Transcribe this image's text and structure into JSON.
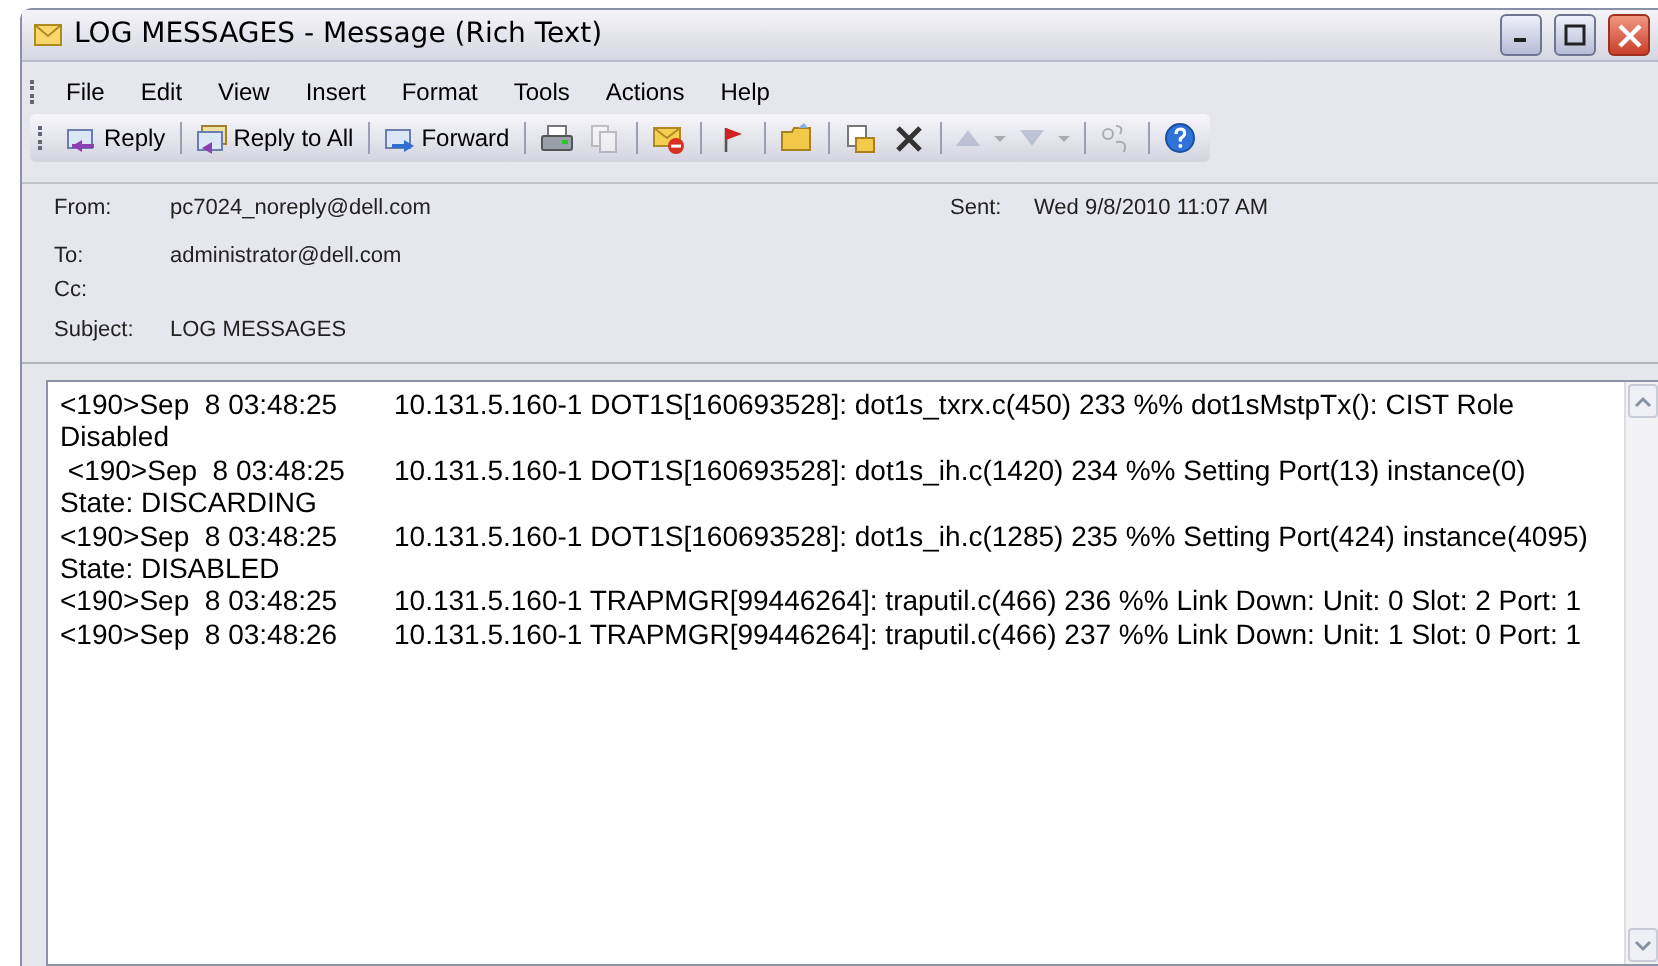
{
  "window": {
    "title": "LOG MESSAGES - Message (Rich Text)"
  },
  "menu": [
    "File",
    "Edit",
    "View",
    "Insert",
    "Format",
    "Tools",
    "Actions",
    "Help"
  ],
  "toolbar": [
    {
      "kind": "labeled",
      "label": "Reply",
      "disabled": false
    },
    {
      "kind": "separator"
    },
    {
      "kind": "labeled",
      "label": "Reply to All",
      "disabled": false
    },
    {
      "kind": "separator"
    },
    {
      "kind": "labeled",
      "label": "Forward",
      "disabled": false
    },
    {
      "kind": "separator"
    },
    {
      "kind": "icon",
      "disabled": false
    },
    {
      "kind": "icon",
      "disabled": true
    },
    {
      "kind": "separator"
    },
    {
      "kind": "icon",
      "disabled": false
    },
    {
      "kind": "separator"
    },
    {
      "kind": "icon",
      "disabled": false
    },
    {
      "kind": "separator"
    },
    {
      "kind": "icon",
      "disabled": false
    },
    {
      "kind": "separator"
    },
    {
      "kind": "icon",
      "disabled": false
    },
    {
      "kind": "icon",
      "disabled": false
    },
    {
      "kind": "separator"
    },
    {
      "kind": "icon",
      "disabled": true
    },
    {
      "kind": "icon",
      "disabled": true
    },
    {
      "kind": "icon",
      "disabled": true
    },
    {
      "kind": "icon",
      "disabled": true
    },
    {
      "kind": "separator"
    },
    {
      "kind": "icon",
      "disabled": true
    },
    {
      "kind": "separator"
    },
    {
      "kind": "icon",
      "disabled": false
    }
  ],
  "header": {
    "from_label": "From:",
    "from": "pc7024_noreply@dell.com",
    "sent_label": "Sent:",
    "sent": "Wed 9/8/2010  11:07 AM",
    "to_label": "To:",
    "to": "administrator@dell.com",
    "cc_label": "Cc:",
    "subject_label": "Subject:",
    "subject": "LOG MESSAGES"
  },
  "body": [
    {
      "stamp": "<190>Sep  8 03:48:25",
      "text": "10.131.5.160-1 DOT1S[160693528]: dot1s_txrx.c(450) 233 %% dot1sMstpTx(): CIST Role",
      "wrap": "Disabled"
    },
    {
      "stamp": " <190>Sep  8 03:48:25",
      "text": "10.131.5.160-1 DOT1S[160693528]: dot1s_ih.c(1420) 234 %% Setting Port(13) instance(0)",
      "wrap": "State: DISCARDING"
    },
    {
      "stamp": "<190>Sep  8 03:48:25",
      "text": "10.131.5.160-1 DOT1S[160693528]: dot1s_ih.c(1285) 235 %% Setting Port(424) instance(4095)",
      "wrap": "State: DISABLED"
    },
    {
      "stamp": "<190>Sep  8 03:48:25",
      "text": "10.131.5.160-1 TRAPMGR[99446264]: traputil.c(466) 236 %% Link Down: Unit: 0 Slot: 2 Port: 1"
    },
    {
      "stamp": "<190>Sep  8 03:48:26",
      "text": "10.131.5.160-1 TRAPMGR[99446264]: traputil.c(466) 237 %% Link Down: Unit: 1 Slot: 0 Port: 1"
    }
  ]
}
